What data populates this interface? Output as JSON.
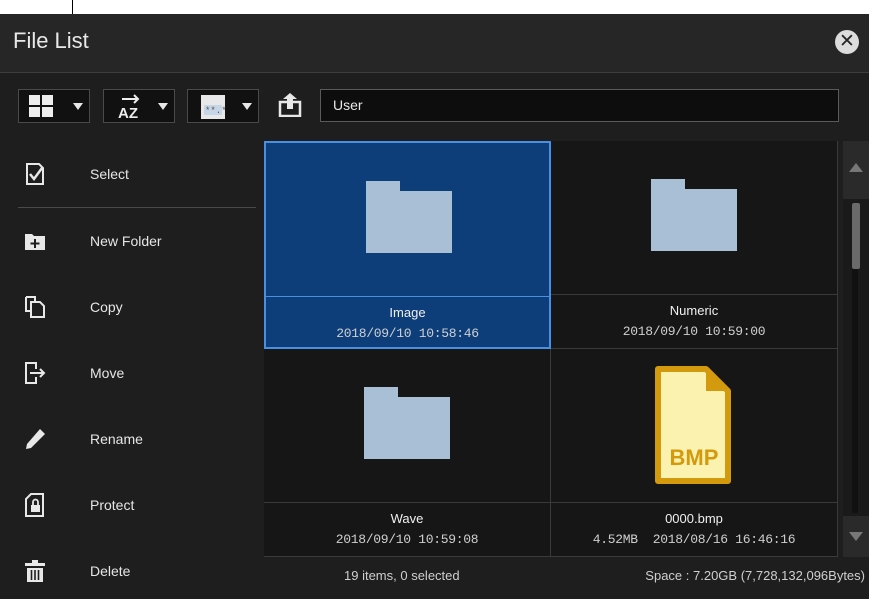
{
  "window": {
    "title": "File List"
  },
  "toolbar": {
    "path_value": "User",
    "view_icon": "grid-view-icon",
    "sort_icon": "sort-az-icon",
    "filter_icon": "file-type-filter-icon",
    "up_icon": "upload-folder-icon"
  },
  "sidebar": {
    "items": [
      {
        "label": "Select",
        "icon": "checkbox-icon"
      },
      {
        "label": "New Folder",
        "icon": "new-folder-icon"
      },
      {
        "label": "Copy",
        "icon": "copy-icon"
      },
      {
        "label": "Move",
        "icon": "move-icon"
      },
      {
        "label": "Rename",
        "icon": "pencil-icon"
      },
      {
        "label": "Protect",
        "icon": "lock-file-icon"
      },
      {
        "label": "Delete",
        "icon": "trash-icon"
      }
    ]
  },
  "files": [
    {
      "name": "Image",
      "date": "2018/09/10 10:58:46",
      "type": "folder",
      "selected": true
    },
    {
      "name": "Numeric",
      "date": "2018/09/10 10:59:00",
      "type": "folder",
      "selected": false
    },
    {
      "name": "Wave",
      "date": "2018/09/10 10:59:08",
      "type": "folder",
      "selected": false
    },
    {
      "name": "0000.bmp",
      "date": "4.52MB  2018/08/16 16:46:16",
      "type": "bmp",
      "badge": "BMP",
      "selected": false
    }
  ],
  "status": {
    "items": "19 items, 0 selected",
    "space": "Space : 7.20GB (7,728,132,096Bytes)"
  },
  "colors": {
    "folder": "#a9bfd6",
    "selected_bg": "#0d3e7a",
    "selected_border": "#4a90e2",
    "bmp_gold": "#d49a0e",
    "bmp_paper": "#fbf2b0"
  }
}
